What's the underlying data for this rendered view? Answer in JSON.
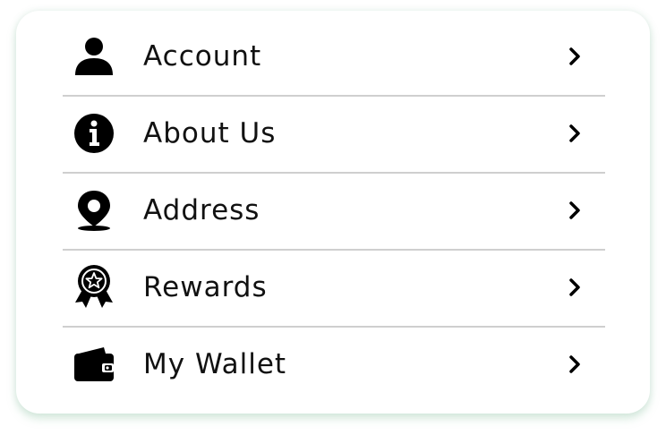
{
  "menu": {
    "items": [
      {
        "label": "Account",
        "icon": "person-icon"
      },
      {
        "label": "About Us",
        "icon": "info-icon"
      },
      {
        "label": "Address",
        "icon": "map-pin-icon"
      },
      {
        "label": "Rewards",
        "icon": "award-ribbon-icon"
      },
      {
        "label": "My Wallet",
        "icon": "wallet-icon"
      }
    ]
  },
  "colors": {
    "text": "#111111",
    "divider": "#cfcfcf",
    "card_shadow": "#c8e6d2"
  }
}
